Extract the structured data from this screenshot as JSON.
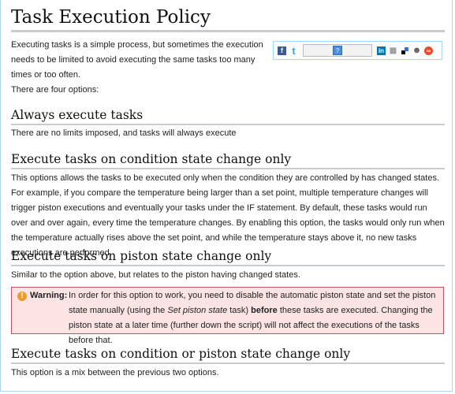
{
  "page": {
    "title": "Task Execution Policy",
    "intro": "Executing tasks is a simple process, but sometimes the execution needs to be limited to avoid executing the same tasks too many times or too often.",
    "options_intro": "There are four options:"
  },
  "share_bar": {
    "icons": [
      "facebook-icon",
      "twitter-icon",
      "help-icon",
      "linkedin-icon",
      "delicious-buttons-icon",
      "delicious-icon",
      "reddit-icon",
      "stumbleupon-icon"
    ],
    "help_label": "?",
    "facebook_glyph": "f",
    "twitter_glyph": "t",
    "linkedin_glyph": "in"
  },
  "sections": [
    {
      "heading": "Always execute tasks",
      "body": "There are no limits imposed, and tasks will always execute"
    },
    {
      "heading": "Execute tasks on condition state change only",
      "body": "This options allows the tasks to be executed only when the condition they are controlled by has changed states. For example, if you compare the temperature being larger than a set point, multiple temperature changes will trigger piston executions and eventually your tasks under the IF statement. By default, these tasks would run over and over again, every time the temperature changes. By enabling this option, the tasks would only run when the temperature actually rises above the set point, and while the temperature stays above it, no new tasks executions are performed."
    },
    {
      "heading": "Execute tasks on piston state change only",
      "body": "Similar to the option above, but relates to the piston having changed states."
    },
    {
      "heading": "Execute tasks on condition or piston state change only",
      "body": "This option is a mix between the previous two options."
    }
  ],
  "warning": {
    "icon": "!",
    "label": "Warning:",
    "text_part1": "In order for this option to work, you need to disable the automatic piston state and set the piston state manually (using the ",
    "text_italic": "Set piston state",
    "text_part2": " task) ",
    "text_bold": "before",
    "text_part3": " these tasks are executed. Changing the piston state at a later time (further down the script) will not affect the executions of the tasks before that."
  }
}
